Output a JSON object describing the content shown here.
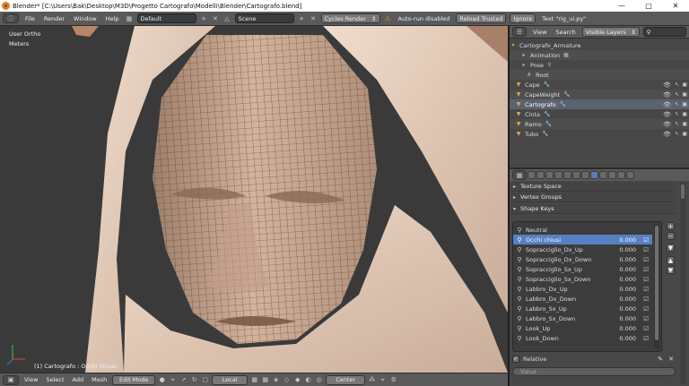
{
  "window": {
    "title": "Blender* [C:\\Users\\Bak\\Desktop\\M3D\\Progetto Cartografo\\Modelli\\Blender\\Cartografo.blend]",
    "min_icon": "minimize-icon",
    "max_icon": "maximize-icon",
    "close_icon": "close-icon"
  },
  "infobar": {
    "menus": [
      "File",
      "Render",
      "Window",
      "Help"
    ],
    "layout": "Default",
    "scene": "Scene",
    "engine": "Cycles Render",
    "autorun": "Auto-run disabled",
    "reload": "Reload Trusted",
    "ignore": "Ignore",
    "text_status": "Text \"rig_ui.py\""
  },
  "viewport": {
    "view_label": "User Ortho",
    "units_label": "Meters",
    "object_info": "(1) Cartografo : Occhi chiusi",
    "skin_color": "#c9a58c",
    "cloth_color": "#e9d2c0"
  },
  "bottombar": {
    "menus": [
      "View",
      "Select",
      "Add",
      "Mesh"
    ],
    "mode": "Edit Mode",
    "orientation": "Local",
    "pivot": "Center"
  },
  "outliner": {
    "header": {
      "view": "View",
      "search": "Search",
      "filter": "Visible Layers"
    },
    "rows": [
      {
        "name": "Cartografo_Armature",
        "kind": "armature"
      },
      {
        "name": "Animation",
        "kind": "data"
      },
      {
        "name": "Pose",
        "kind": "data"
      },
      {
        "name": "Root",
        "kind": "bone"
      },
      {
        "name": "Cape",
        "kind": "mesh"
      },
      {
        "name": "CapeWeight",
        "kind": "mesh"
      },
      {
        "name": "Cartografo",
        "kind": "mesh",
        "selected": true
      },
      {
        "name": "Cinta",
        "kind": "mesh"
      },
      {
        "name": "Ramo",
        "kind": "mesh"
      },
      {
        "name": "Tubo",
        "kind": "mesh"
      }
    ]
  },
  "properties": {
    "panels": {
      "texture_space": "Texture Space",
      "vertex_groups": "Vertex Groups",
      "shape_keys": "Shape Keys"
    },
    "shape_keys": [
      {
        "name": "Neutral",
        "value": ""
      },
      {
        "name": "Occhi chiusi",
        "value": "0.000",
        "selected": true
      },
      {
        "name": "Sopracciglio_Dx_Up",
        "value": "0.000"
      },
      {
        "name": "Sopracciglio_Dx_Down",
        "value": "0.000"
      },
      {
        "name": "Sopracciglio_Sx_Up",
        "value": "0.000"
      },
      {
        "name": "Sopracciglio_Sx_Down",
        "value": "0.000"
      },
      {
        "name": "Labbro_Dx_Up",
        "value": "0.000"
      },
      {
        "name": "Labbro_Dx_Down",
        "value": "0.000"
      },
      {
        "name": "Labbro_Sx_Up",
        "value": "0.000"
      },
      {
        "name": "Labbro_Sx_Down",
        "value": "0.000"
      },
      {
        "name": "Look_Up",
        "value": "0.000"
      },
      {
        "name": "Look_Down",
        "value": "0.000"
      }
    ],
    "relative_label": "Relative",
    "value_label": "Value"
  },
  "colors": {
    "accent": "#5680c2",
    "header": "#5a5a5a",
    "panel": "#474747"
  }
}
